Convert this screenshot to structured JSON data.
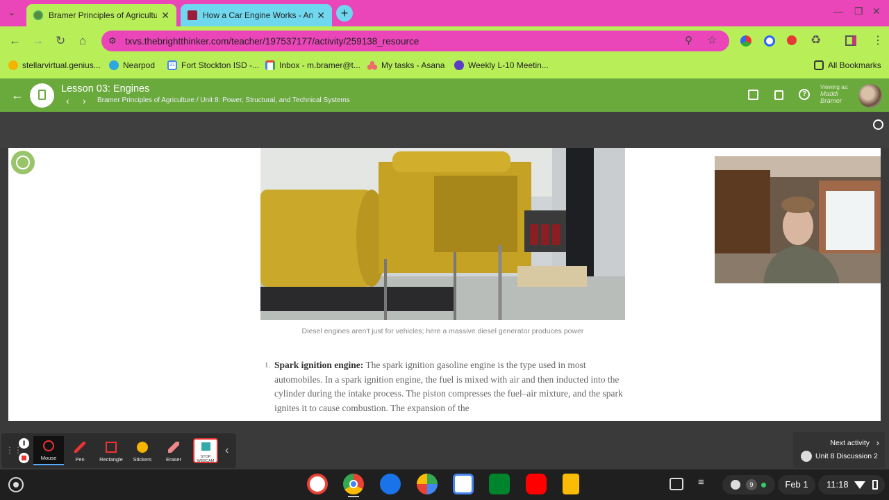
{
  "browser": {
    "tabs": [
      {
        "title": "Bramer Principles of Agricultu"
      },
      {
        "title": "How a Car Engine Works - Ani"
      }
    ],
    "url": "txvs.thebrightthinker.com/teacher/197537177/activity/259138_resource",
    "bookmarks": [
      {
        "label": "stellarvirtual.genius..."
      },
      {
        "label": "Nearpod"
      },
      {
        "label": "Fort Stockton ISD -..."
      },
      {
        "label": "Inbox - m.bramer@t..."
      },
      {
        "label": "My tasks - Asana"
      },
      {
        "label": "Weekly L-10 Meetin..."
      }
    ],
    "all_bookmarks": "All Bookmarks",
    "calendar_day": "31"
  },
  "lesson": {
    "title": "Lesson 03: Engines",
    "breadcrumb": "Bramer Principles of Agriculture / Unit 8: Power, Structural, and Technical Systems",
    "viewing_as_label": "Viewing as:",
    "viewing_as_name_1": "Maddi",
    "viewing_as_name_2": "Bramer"
  },
  "content": {
    "caption": "Diesel engines aren't just for vehicles; here a massive diesel generator produces power",
    "list_number": "1.",
    "term": "Spark ignition engine:",
    "paragraph": "The spark ignition gasoline engine is the type used in most automobiles. In a spark ignition engine, the fuel is mixed with air and then inducted into the cylinder during the intake process. The piston compresses the fuel–air mixture, and the spark ignites it to cause combustion. The expansion of the"
  },
  "annotation_tools": [
    {
      "label": "Mouse"
    },
    {
      "label": "Pen"
    },
    {
      "label": "Rectangle"
    },
    {
      "label": "Stickers"
    },
    {
      "label": "Eraser"
    }
  ],
  "stop_webcam": {
    "line1": "STOP",
    "line2": "WEBCAM"
  },
  "next_activity": {
    "label": "Next activity",
    "name": "Unit 8 Discussion 2"
  },
  "shelf": {
    "notification_count": "9",
    "date": "Feb 1",
    "time": "11:18"
  },
  "colors": {
    "tabstrip": "#ea46b9",
    "toolbar": "#b8ef58",
    "tab2": "#6fd7ee",
    "lesson_bar": "#6aa93c"
  }
}
